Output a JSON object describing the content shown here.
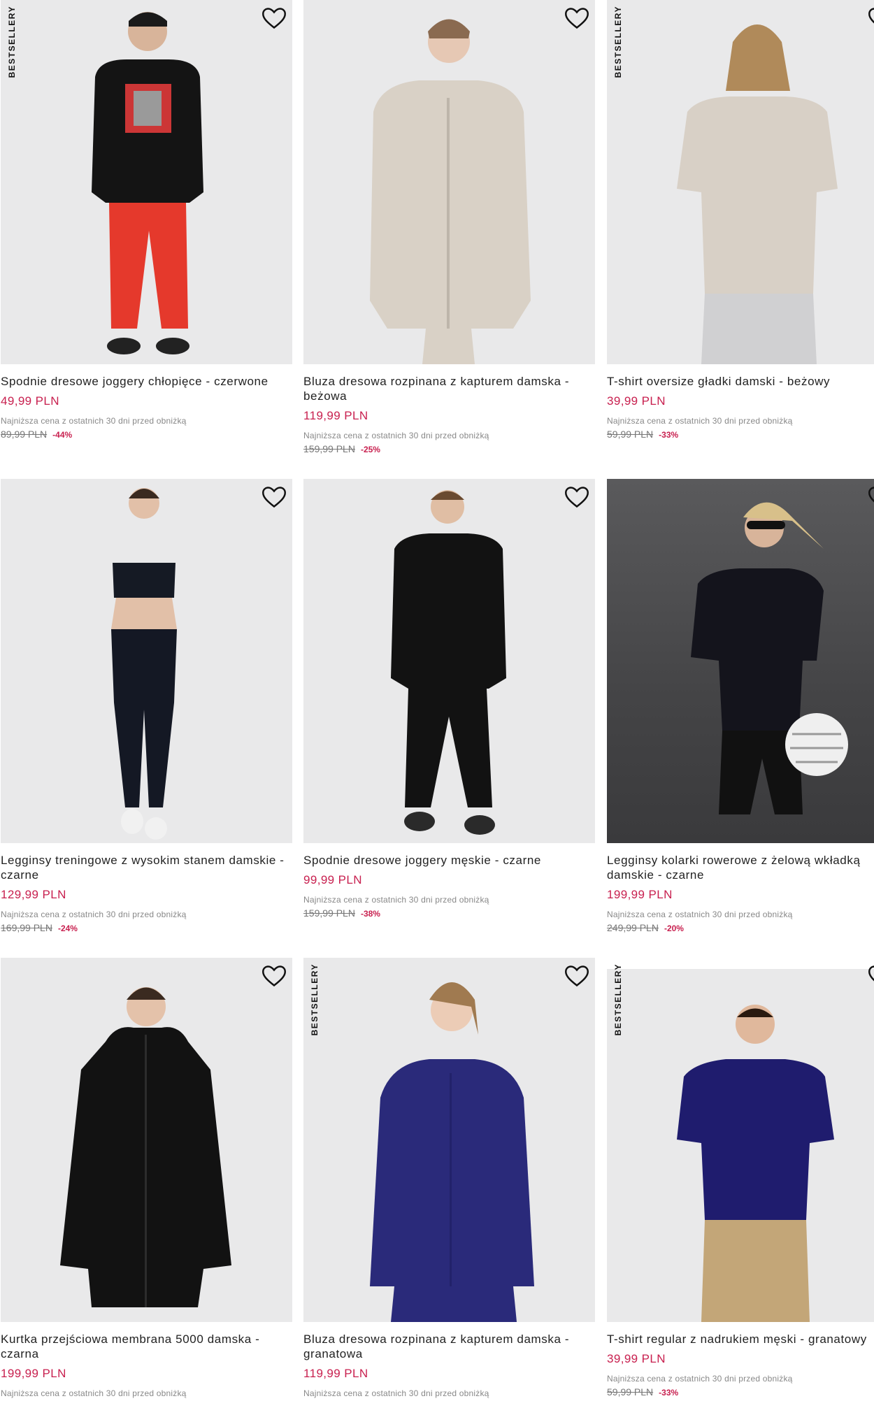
{
  "products": [
    {
      "badge": "BESTSELLERY",
      "name": "Spodnie dresowe joggery chłopięce - czerwone",
      "price": "49,99 PLN",
      "lowest_label": "Najniższa cena z ostatnich 30 dni przed obniżką",
      "old_price": "89,99 PLN",
      "discount": "-44%",
      "image_desc": "boy-black-hoodie-red-joggers"
    },
    {
      "badge": "",
      "name": "Bluza dresowa rozpinana z kapturem damska - beżowa",
      "price": "119,99 PLN",
      "lowest_label": "Najniższa cena z ostatnich 30 dni przed obniżką",
      "old_price": "159,99 PLN",
      "discount": "-25%",
      "image_desc": "woman-beige-zip-hoodie"
    },
    {
      "badge": "BESTSELLERY",
      "name": "T-shirt oversize gładki damski - beżowy",
      "price": "39,99 PLN",
      "lowest_label": "Najniższa cena z ostatnich 30 dni przed obniżką",
      "old_price": "59,99 PLN",
      "discount": "-33%",
      "image_desc": "woman-beige-tshirt"
    },
    {
      "badge": "",
      "name": "Legginsy treningowe z wysokim stanem damskie - czarne",
      "price": "129,99 PLN",
      "lowest_label": "Najniższa cena z ostatnich 30 dni przed obniżką",
      "old_price": "169,99 PLN",
      "discount": "-24%",
      "image_desc": "woman-black-leggings-sports-bra"
    },
    {
      "badge": "",
      "name": "Spodnie dresowe joggery męskie - czarne",
      "price": "99,99 PLN",
      "lowest_label": "Najniższa cena z ostatnich 30 dni przed obniżką",
      "old_price": "159,99 PLN",
      "discount": "-38%",
      "image_desc": "man-black-hoodie-joggers"
    },
    {
      "badge": "",
      "name": "Legginsy kolarki rowerowe z żelową wkładką damskie - czarne",
      "price": "199,99 PLN",
      "lowest_label": "Najniższa cena z ostatnich 30 dni przed obniżką",
      "old_price": "249,99 PLN",
      "discount": "-20%",
      "image_desc": "woman-cycling-kit-helmet"
    },
    {
      "badge": "",
      "name": "Kurtka przejściowa membrana 5000 damska - czarna",
      "price": "199,99 PLN",
      "lowest_label": "Najniższa cena z ostatnich 30 dni przed obniżką",
      "old_price": "",
      "discount": "",
      "image_desc": "woman-black-jacket"
    },
    {
      "badge": "BESTSELLERY",
      "name": "Bluza dresowa rozpinana z kapturem damska - granatowa",
      "price": "119,99 PLN",
      "lowest_label": "Najniższa cena z ostatnich 30 dni przed obniżką",
      "old_price": "",
      "discount": "",
      "image_desc": "woman-navy-zip-hoodie"
    },
    {
      "badge": "BESTSELLERY",
      "name": "T-shirt regular z nadrukiem męski - granatowy",
      "price": "39,99 PLN",
      "lowest_label": "Najniższa cena z ostatnich 30 dni przed obniżką",
      "old_price": "59,99 PLN",
      "discount": "-33%",
      "image_desc": "man-navy-tshirt-khaki"
    }
  ],
  "colors": {
    "price": "#c8204f",
    "discount": "#c8204f",
    "text": "#222222",
    "muted": "#888888",
    "image_bg": "#e9e9ea"
  },
  "icons": {
    "wishlist": "heart-outline-icon"
  }
}
